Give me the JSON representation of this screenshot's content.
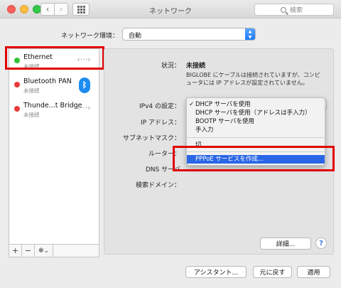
{
  "window": {
    "title": "ネットワーク",
    "search_placeholder": "検索"
  },
  "location": {
    "label": "ネットワーク環境：",
    "value": "自動"
  },
  "services": [
    {
      "name": "Ethernet",
      "status": "未接続",
      "status_color": "#2fc437"
    },
    {
      "name": "Bluetooth PAN",
      "status": "未接続",
      "status_color": "#ea3a3a"
    },
    {
      "name": "Thunde...t Bridge",
      "status": "未接続",
      "status_color": "#ea3a3a"
    }
  ],
  "sidebar_toolbar": {
    "add": "+",
    "remove": "−",
    "gear": "✻⌄"
  },
  "detail": {
    "status_label": "状況：",
    "status_value": "未接続",
    "status_desc": "BIGLOBE にケーブルは接続されていますが、コンピュータには IP アドレスが設定されていません。",
    "ipv4_label": "IPv4 の設定：",
    "ip_label": "IP アドレス：",
    "subnet_label": "サブネットマスク：",
    "router_label": "ルーター：",
    "dns_label": "DNS サーバ",
    "search_domain_label": "検索ドメイン："
  },
  "ipv4_menu": {
    "items": [
      {
        "label": "DHCP サーバを使用",
        "checked": "✓"
      },
      {
        "label": "DHCP サーバを使用（アドレスは手入力）"
      },
      {
        "label": "BOOTP サーバを使用"
      },
      {
        "label": "手入力"
      },
      {
        "label": "切"
      },
      {
        "label": "PPPoE サービスを作成..."
      }
    ]
  },
  "buttons": {
    "advanced": "詳細...",
    "help": "?",
    "assistant": "アシスタント...",
    "revert": "元に戻す",
    "apply": "適用"
  },
  "colors": {
    "highlight": "#e00000",
    "menu_selection": "#2a66e6",
    "accent": "#1a7cf5"
  }
}
